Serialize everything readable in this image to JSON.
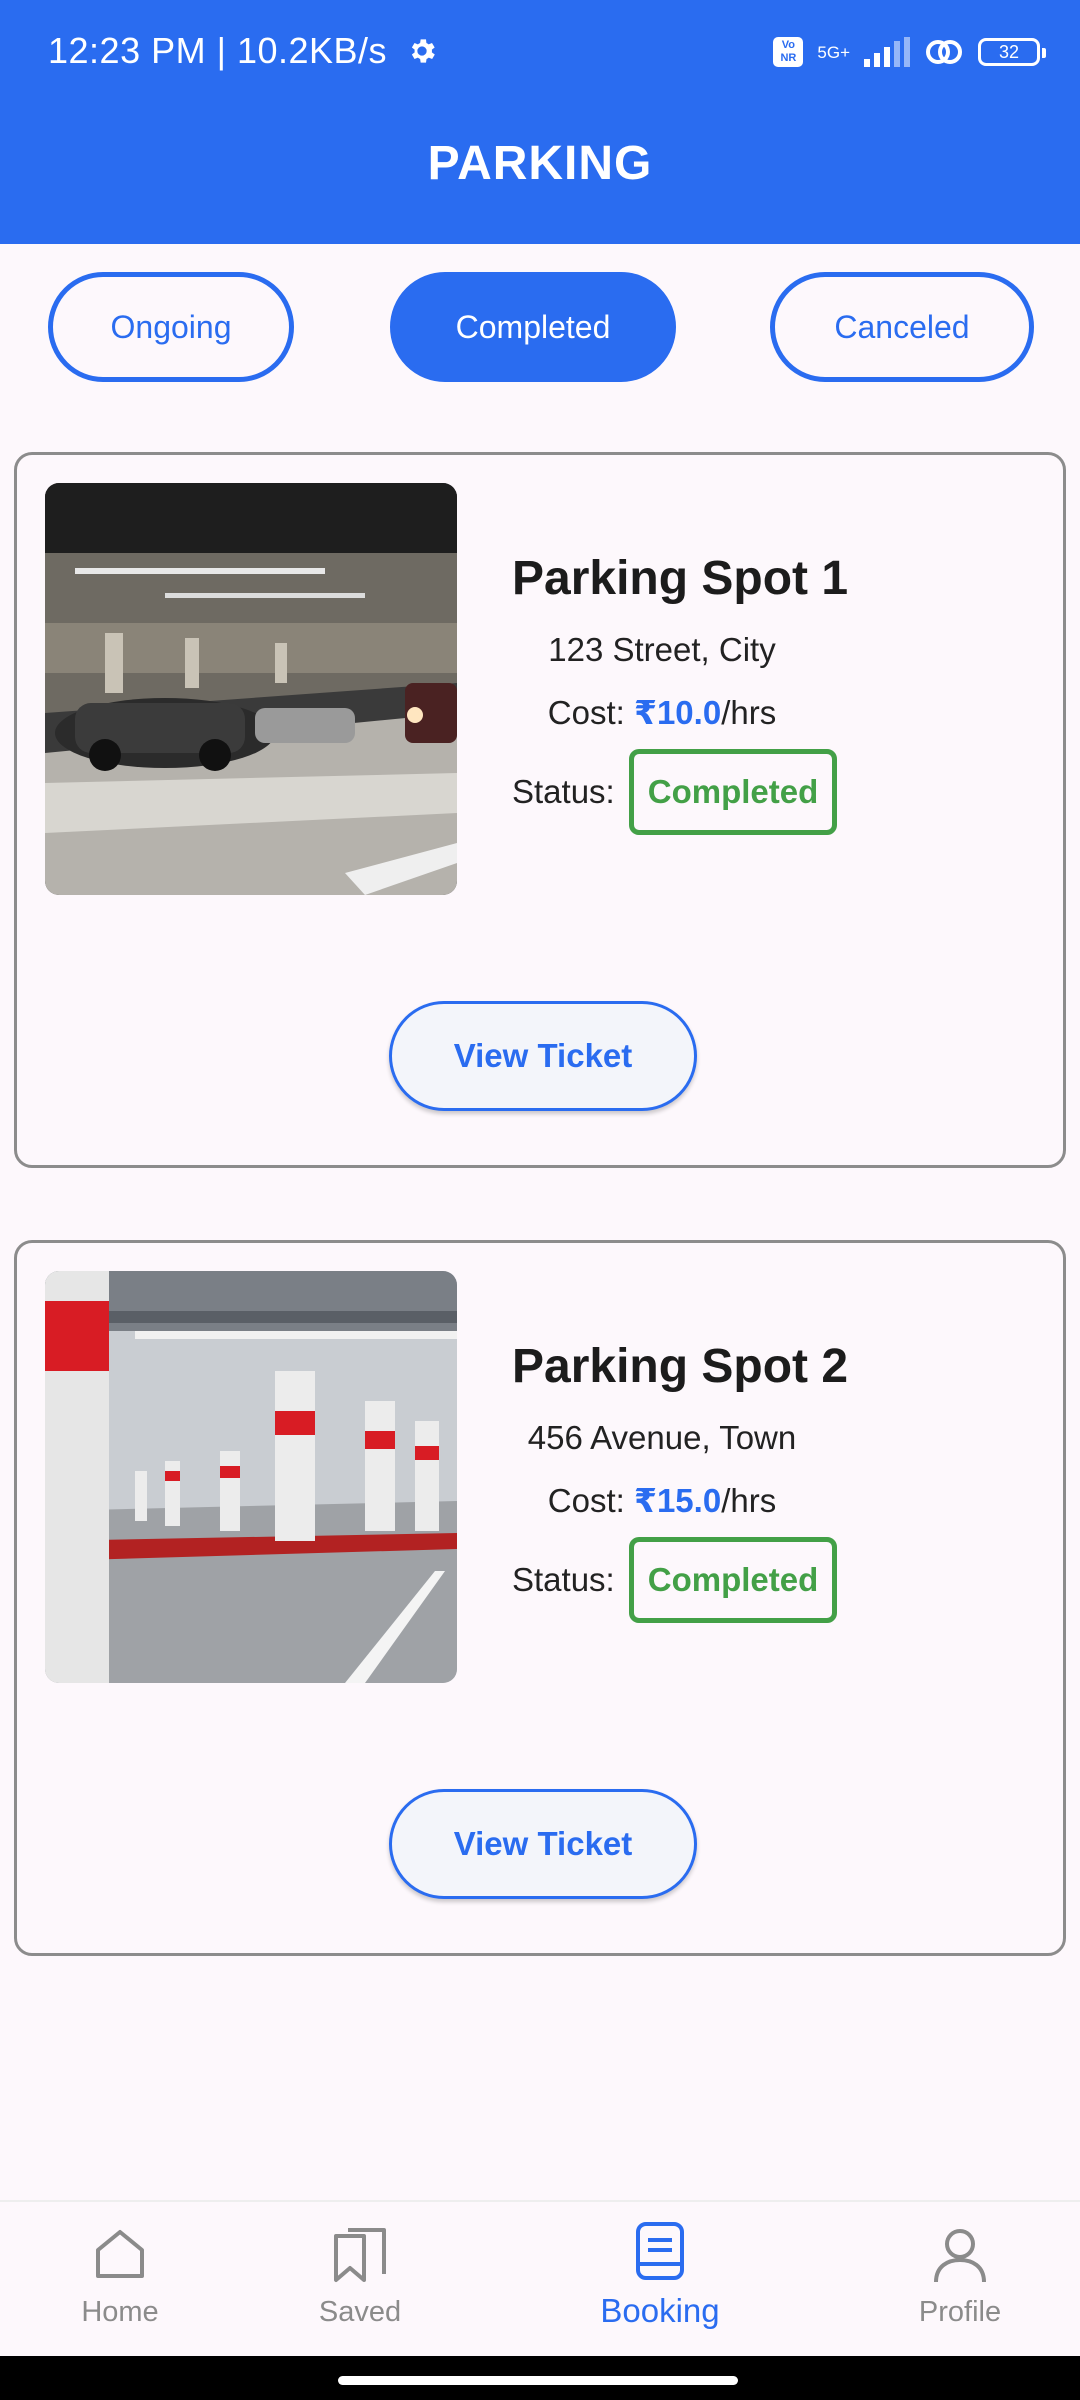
{
  "status_bar": {
    "time": "12:23 PM | 10.2KB/s",
    "network": "5G+",
    "volte": "Vo NR",
    "battery": "32"
  },
  "header": {
    "title": "PARKING"
  },
  "tabs": [
    {
      "label": "Ongoing",
      "active": false
    },
    {
      "label": "Completed",
      "active": true
    },
    {
      "label": "Canceled",
      "active": false
    }
  ],
  "bookings": [
    {
      "name": "Parking Spot 1",
      "address": "123 Street, City",
      "cost_prefix": "Cost: ",
      "cost_amount": "₹10.0",
      "cost_suffix": "/hrs",
      "status_label": "Status:",
      "status": "Completed",
      "button": "View Ticket"
    },
    {
      "name": "Parking Spot 2",
      "address": "456 Avenue, Town",
      "cost_prefix": "Cost: ",
      "cost_amount": "₹15.0",
      "cost_suffix": "/hrs",
      "status_label": "Status:",
      "status": "Completed",
      "button": "View Ticket"
    }
  ],
  "bottom_nav": [
    {
      "label": "Home",
      "icon": "home-icon",
      "active": false
    },
    {
      "label": "Saved",
      "icon": "saved-icon",
      "active": false
    },
    {
      "label": "Booking",
      "icon": "booking-icon",
      "active": true
    },
    {
      "label": "Profile",
      "icon": "profile-icon",
      "active": false
    }
  ],
  "colors": {
    "primary": "#2a6cf0",
    "status_completed": "#43a047",
    "background": "#fdf8fc"
  }
}
